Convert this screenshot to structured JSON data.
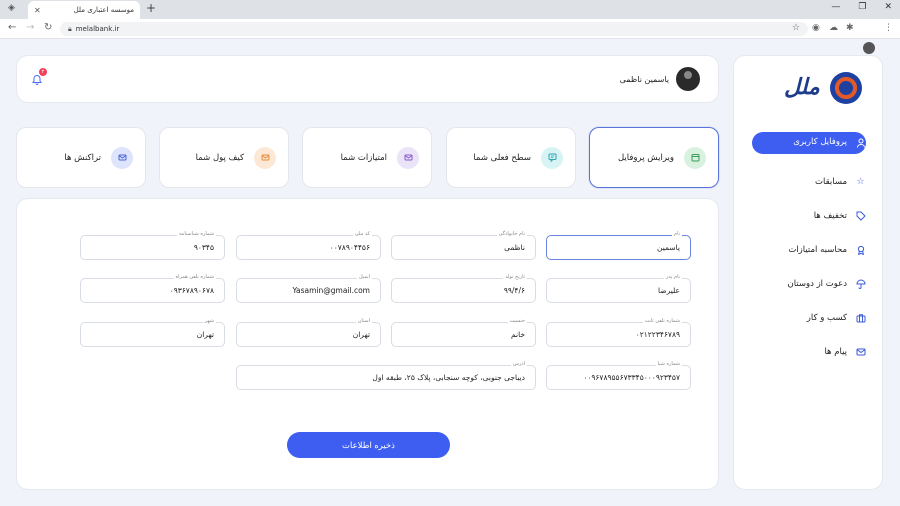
{
  "browser": {
    "tab_title": "موسسه اعتباری ملل",
    "url": "melalbank.ir"
  },
  "header": {
    "user_name": "یاسمین ناظمی",
    "notification_count": "۲"
  },
  "sidebar": {
    "items": [
      {
        "label": "پروفایل کاربری",
        "icon": "user-icon",
        "active": true
      },
      {
        "label": "مسابقات",
        "icon": "star-icon"
      },
      {
        "label": "تخفیف ها",
        "icon": "tag-icon"
      },
      {
        "label": "محاسبه امتیازات",
        "icon": "award-icon"
      },
      {
        "label": "دعوت از دوستان",
        "icon": "umbrella-icon"
      },
      {
        "label": "کسب و کار",
        "icon": "briefcase-icon"
      },
      {
        "label": "پیام ها",
        "icon": "mail-icon"
      }
    ]
  },
  "tabs": [
    {
      "label": "ویرایش پروفایل",
      "icon": "calendar-icon",
      "bg": "#d9f2df",
      "color": "#3a9b57",
      "active": true
    },
    {
      "label": "سطح فعلی شما",
      "icon": "chat-icon",
      "bg": "#d8f3f4",
      "color": "#2aa6b0"
    },
    {
      "label": "امتیازات شما",
      "icon": "mail-icon",
      "bg": "#ebe3f8",
      "color": "#8a5ad0"
    },
    {
      "label": "کیف پول شما",
      "icon": "mail-icon",
      "bg": "#fde8d6",
      "color": "#e58a3a"
    },
    {
      "label": "تراکنش ها",
      "icon": "mail-icon",
      "bg": "#dde4fb",
      "color": "#4a63d8"
    }
  ],
  "form": {
    "first_name": {
      "label": "نام",
      "value": "یاسمین"
    },
    "last_name": {
      "label": "نام خانوادگی",
      "value": "ناظمی"
    },
    "national_code": {
      "label": "کد ملی",
      "value": "۰۰۷۸۹۰۴۴۵۶"
    },
    "id_number": {
      "label": "شماره شناسنامه",
      "value": "۹۰۳۴۵"
    },
    "father_name": {
      "label": "نام پدر",
      "value": "علیرضا"
    },
    "birth_date": {
      "label": "تاریخ تولد",
      "value": "۹۹/۴/۶"
    },
    "email": {
      "label": "ایمیل",
      "value": "Yasamin@gmail.com"
    },
    "mobile": {
      "label": "شماره تلفن همراه",
      "value": "۰۹۳۶۷۸۹۰۶۷۸"
    },
    "phone": {
      "label": "شماره تلفن ثابت",
      "value": "۰۲۱۲۲۳۴۶۷۸۹"
    },
    "gender": {
      "label": "جنسیت",
      "value": "خانم"
    },
    "province": {
      "label": "استان",
      "value": "تهران"
    },
    "city": {
      "label": "شهر",
      "value": "تهران"
    },
    "sheba": {
      "label": "شماره شبا",
      "value": "۰۰۹۶۷۸۹۵۵۶۷۳۳۴۵۰۰۰۹۲۳۴۵۷"
    },
    "address": {
      "label": "ادرس",
      "value": "دیباجی جنوبی، کوچه سنجابی، پلاک ۲۵، طبقه اول"
    },
    "save_label": "ذخیره اطلاعات"
  }
}
